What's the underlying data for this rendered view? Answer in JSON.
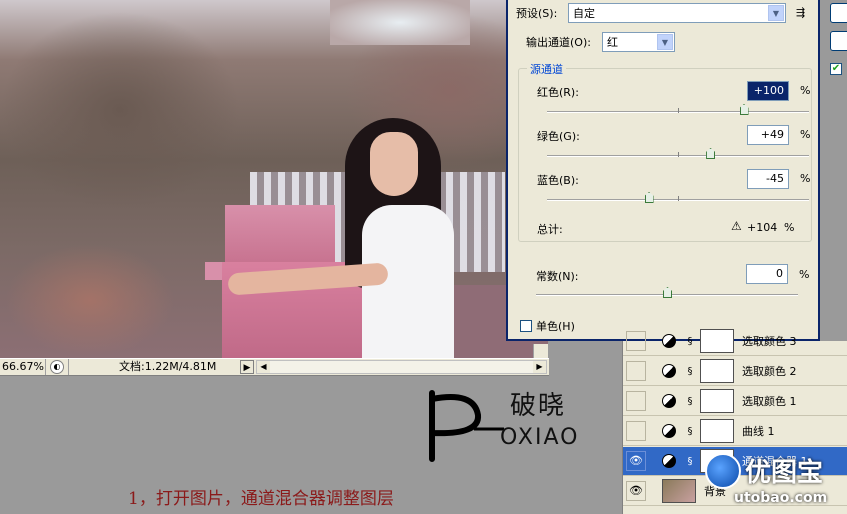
{
  "status_bar": {
    "zoom": "66.67%",
    "doc_size": "文档:1.22M/4.81M"
  },
  "mixer": {
    "preset_label": "预设(S):",
    "preset_value": "自定",
    "output_label": "输出通道(O):",
    "output_value": "红",
    "source_group_title": "源通道",
    "channels": [
      {
        "label": "红色(R):",
        "value": "+100",
        "level": 100
      },
      {
        "label": "绿色(G):",
        "value": "+49",
        "level": 49
      },
      {
        "label": "蓝色(B):",
        "value": "-45",
        "level": -45
      }
    ],
    "percent": "%",
    "total_label": "总计:",
    "total_value": "+104",
    "constant_label": "常数(N):",
    "constant_value": "0",
    "constant_level": 0,
    "monochrome_label": "单色(H)",
    "monochrome_checked": false,
    "preview_checked": true
  },
  "layers": [
    {
      "name": "选取颜色 3",
      "type": "adjustment",
      "visible": false,
      "active": false
    },
    {
      "name": "选取颜色 2",
      "type": "adjustment",
      "visible": false,
      "active": false
    },
    {
      "name": "选取颜色 1",
      "type": "adjustment",
      "visible": false,
      "active": false
    },
    {
      "name": "曲线 1",
      "type": "adjustment",
      "visible": false,
      "active": false
    },
    {
      "name": "通道混合器 1",
      "type": "adjustment",
      "visible": true,
      "active": true
    },
    {
      "name": "背景",
      "type": "photo",
      "visible": true,
      "active": false
    }
  ],
  "caption": "1，打开图片，通道混合器调整图层",
  "logo": {
    "chinese": "破晓",
    "pinyin": "OXIAO"
  },
  "watermark": {
    "name": "优图宝",
    "url": "utobao.com"
  }
}
